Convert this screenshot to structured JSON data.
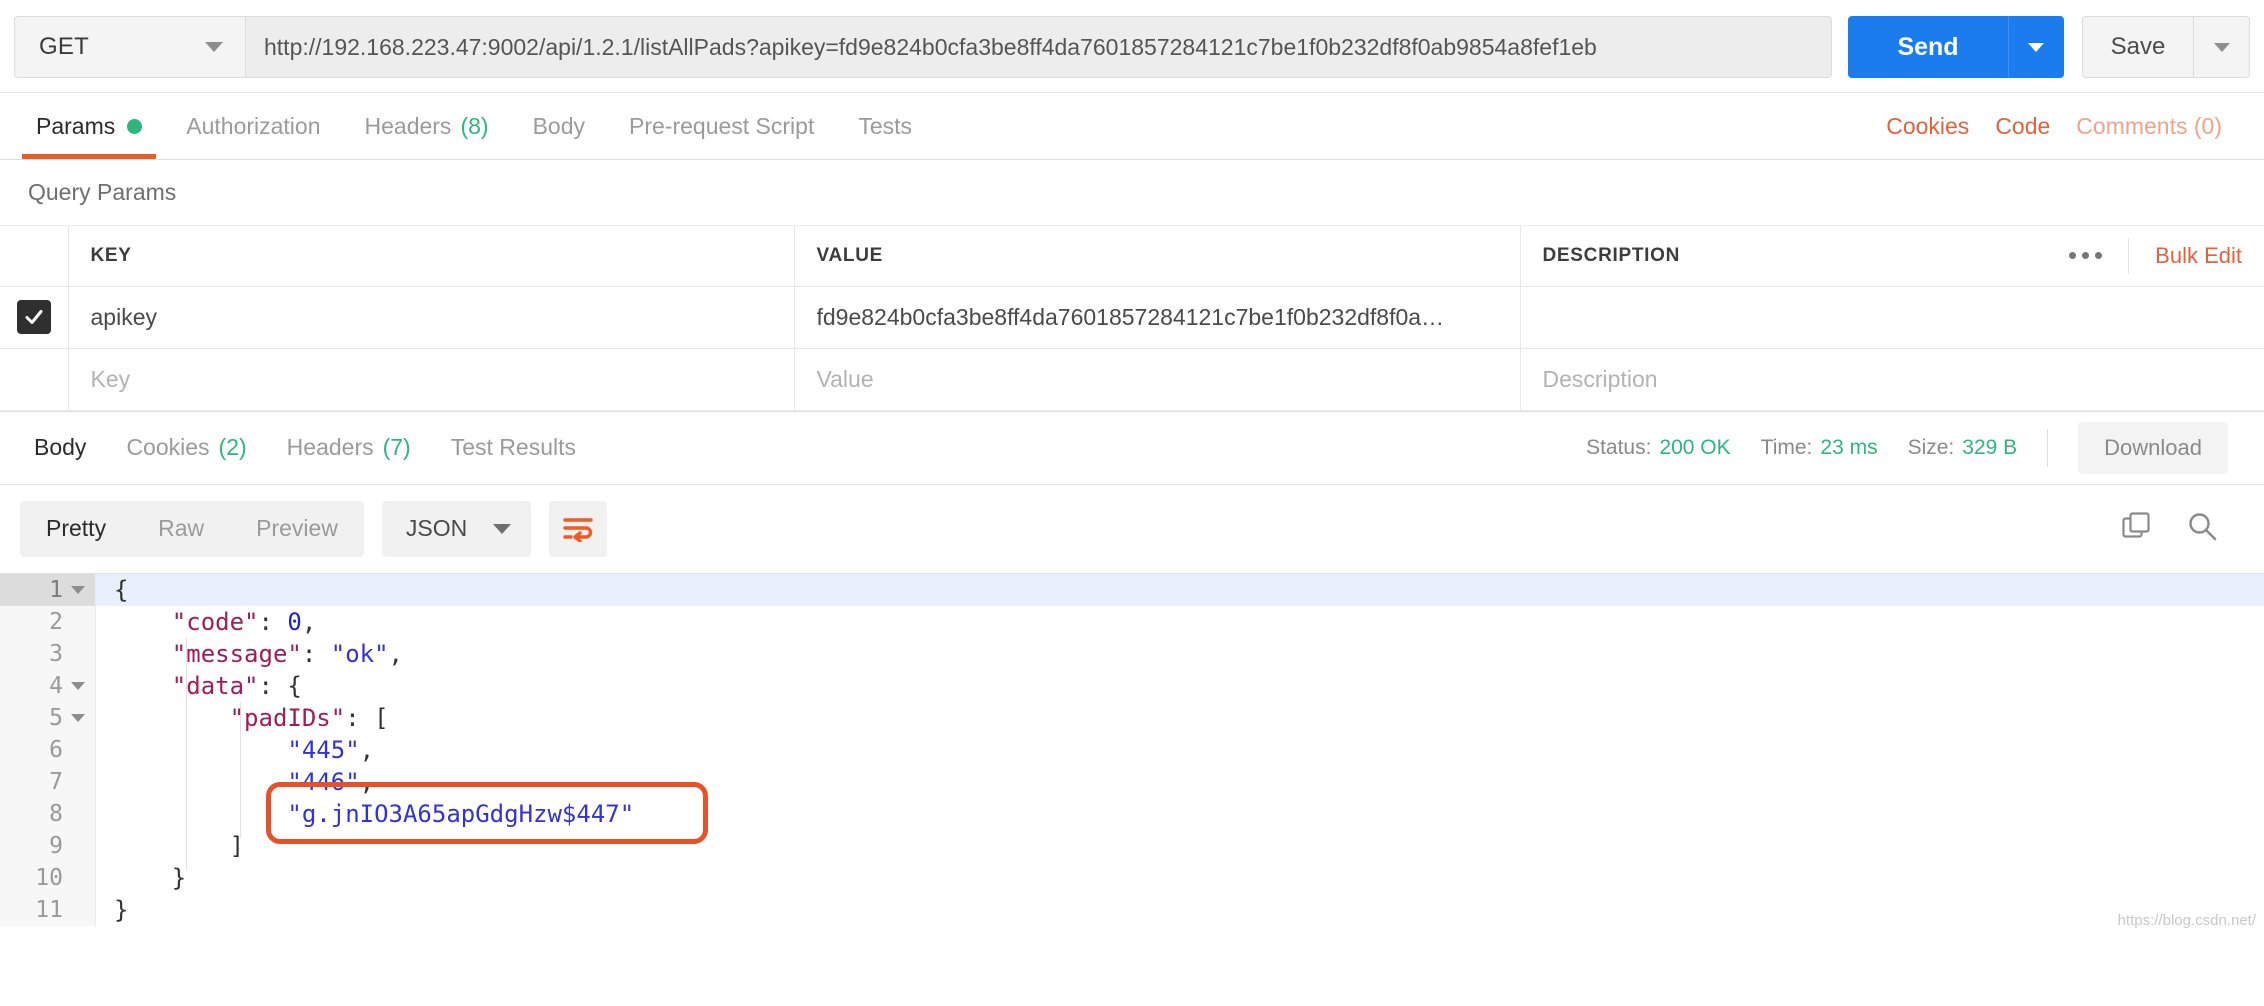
{
  "request": {
    "method": "GET",
    "url": "http://192.168.223.47:9002/api/1.2.1/listAllPads?apikey=fd9e824b0cfa3be8ff4da7601857284121c7be1f0b232df8f0ab9854a8fef1eb",
    "send_label": "Send",
    "save_label": "Save",
    "tabs": [
      {
        "label": "Params",
        "badge": "dot",
        "active": true
      },
      {
        "label": "Authorization",
        "badge": "",
        "active": false
      },
      {
        "label": "Headers",
        "badge": "(8)",
        "active": false
      },
      {
        "label": "Body",
        "badge": "",
        "active": false
      },
      {
        "label": "Pre-request Script",
        "badge": "",
        "active": false
      },
      {
        "label": "Tests",
        "badge": "",
        "active": false
      }
    ],
    "right_links": [
      {
        "label": "Cookies",
        "muted": false
      },
      {
        "label": "Code",
        "muted": false
      },
      {
        "label": "Comments (0)",
        "muted": true
      }
    ]
  },
  "query_params": {
    "section_title": "Query Params",
    "columns": [
      "KEY",
      "VALUE",
      "DESCRIPTION"
    ],
    "bulk_edit_label": "Bulk Edit",
    "rows": [
      {
        "checked": true,
        "key": "apikey",
        "value": "fd9e824b0cfa3be8ff4da7601857284121c7be1f0b232df8f0a…",
        "description": ""
      }
    ],
    "placeholder_row": {
      "key": "Key",
      "value": "Value",
      "description": "Description"
    }
  },
  "response": {
    "tabs": [
      {
        "label": "Body",
        "badge": "",
        "active": true
      },
      {
        "label": "Cookies",
        "badge": "(2)",
        "active": false
      },
      {
        "label": "Headers",
        "badge": "(7)",
        "active": false
      },
      {
        "label": "Test Results",
        "badge": "",
        "active": false
      }
    ],
    "status_label": "Status:",
    "status_value": "200 OK",
    "time_label": "Time:",
    "time_value": "23 ms",
    "size_label": "Size:",
    "size_value": "329 B",
    "download_label": "Download",
    "view_modes": [
      {
        "label": "Pretty",
        "active": true
      },
      {
        "label": "Raw",
        "active": false
      },
      {
        "label": "Preview",
        "active": false
      }
    ],
    "format_label": "JSON",
    "body_lines": [
      {
        "num": "1",
        "fold": true,
        "indent": 0,
        "tokens": [
          {
            "t": "{",
            "c": "p"
          }
        ]
      },
      {
        "num": "2",
        "fold": false,
        "indent": 1,
        "tokens": [
          {
            "t": "\"code\"",
            "c": "k"
          },
          {
            "t": ": ",
            "c": "p"
          },
          {
            "t": "0",
            "c": "n"
          },
          {
            "t": ",",
            "c": "p"
          }
        ]
      },
      {
        "num": "3",
        "fold": false,
        "indent": 1,
        "tokens": [
          {
            "t": "\"message\"",
            "c": "k"
          },
          {
            "t": ": ",
            "c": "p"
          },
          {
            "t": "\"ok\"",
            "c": "s"
          },
          {
            "t": ",",
            "c": "p"
          }
        ]
      },
      {
        "num": "4",
        "fold": true,
        "indent": 1,
        "tokens": [
          {
            "t": "\"data\"",
            "c": "k"
          },
          {
            "t": ": {",
            "c": "p"
          }
        ]
      },
      {
        "num": "5",
        "fold": true,
        "indent": 2,
        "tokens": [
          {
            "t": "\"padIDs\"",
            "c": "k"
          },
          {
            "t": ": [",
            "c": "p"
          }
        ]
      },
      {
        "num": "6",
        "fold": false,
        "indent": 3,
        "tokens": [
          {
            "t": "\"445\"",
            "c": "s"
          },
          {
            "t": ",",
            "c": "p"
          }
        ]
      },
      {
        "num": "7",
        "fold": false,
        "indent": 3,
        "tokens": [
          {
            "t": "\"446\"",
            "c": "s"
          },
          {
            "t": ",",
            "c": "p"
          }
        ]
      },
      {
        "num": "8",
        "fold": false,
        "indent": 3,
        "tokens": [
          {
            "t": "\"g.jnIO3A65apGdgHzw$447\"",
            "c": "s"
          }
        ]
      },
      {
        "num": "9",
        "fold": false,
        "indent": 2,
        "tokens": [
          {
            "t": "]",
            "c": "p"
          }
        ]
      },
      {
        "num": "10",
        "fold": false,
        "indent": 1,
        "tokens": [
          {
            "t": "}",
            "c": "p"
          }
        ]
      },
      {
        "num": "11",
        "fold": false,
        "indent": 0,
        "tokens": [
          {
            "t": "}",
            "c": "p"
          }
        ]
      }
    ],
    "annotation": {
      "target_line": "8",
      "color": "#e8502a"
    },
    "watermark": "https://blog.csdn.net/"
  },
  "colors": {
    "accent_orange": "#ef5b25",
    "link_orange": "#e4613b",
    "send_blue": "#1a7ced",
    "status_green": "#2eb67d",
    "annotation_red": "#e8502a",
    "json_key": "#a11c5c",
    "json_string": "#3232d8"
  }
}
